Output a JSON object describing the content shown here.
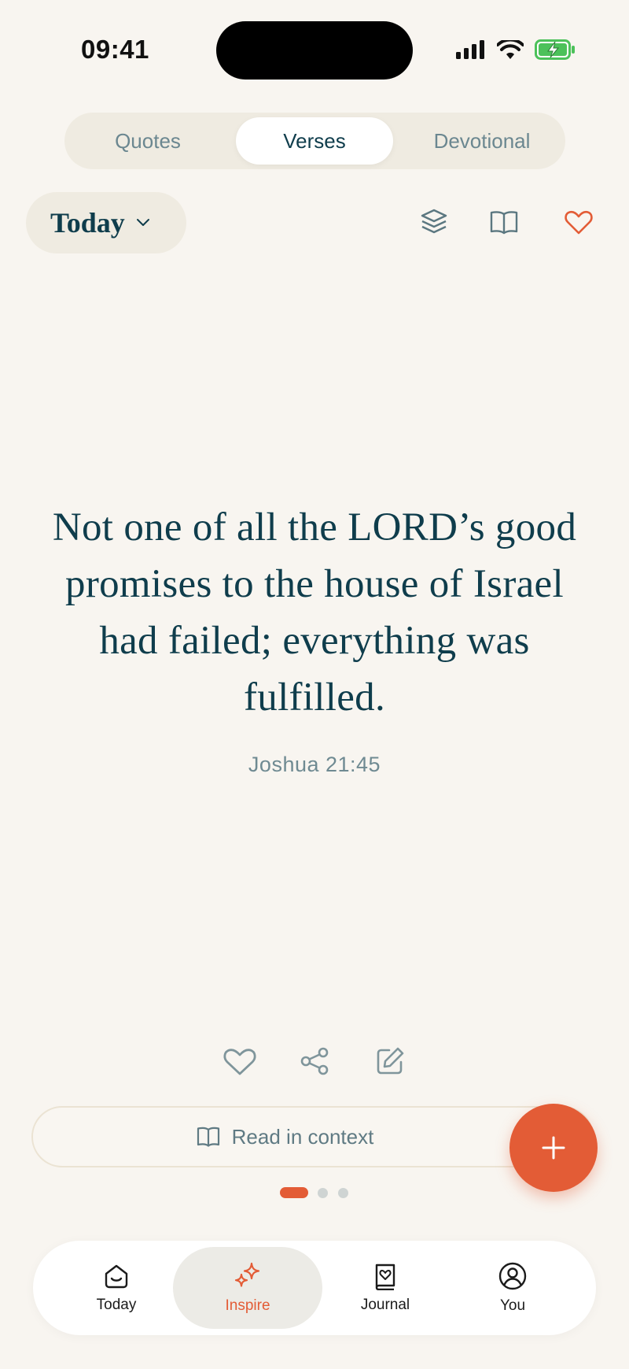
{
  "status_bar": {
    "time": "09:41"
  },
  "segmented": {
    "tabs": [
      "Quotes",
      "Verses",
      "Devotional"
    ],
    "selected": "Verses"
  },
  "filter": {
    "label": "Today"
  },
  "verse": {
    "text": "Not one of all the LORD’s good promises to the house of Israel had failed; everything was fulfilled.",
    "reference": "Joshua 21:45"
  },
  "actions": {
    "read_in_context": "Read in context"
  },
  "pager": {
    "pages": 3,
    "current": 1
  },
  "tabbar": {
    "items": [
      {
        "label": "Today",
        "icon": "home-smile-icon"
      },
      {
        "label": "Inspire",
        "icon": "sparkles-icon"
      },
      {
        "label": "Journal",
        "icon": "journal-heart-icon"
      },
      {
        "label": "You",
        "icon": "user-circle-icon"
      }
    ],
    "selected": "Inspire"
  },
  "colors": {
    "accent": "#e35c36",
    "ink": "#0f3d4c",
    "background": "#f8f5f0"
  }
}
